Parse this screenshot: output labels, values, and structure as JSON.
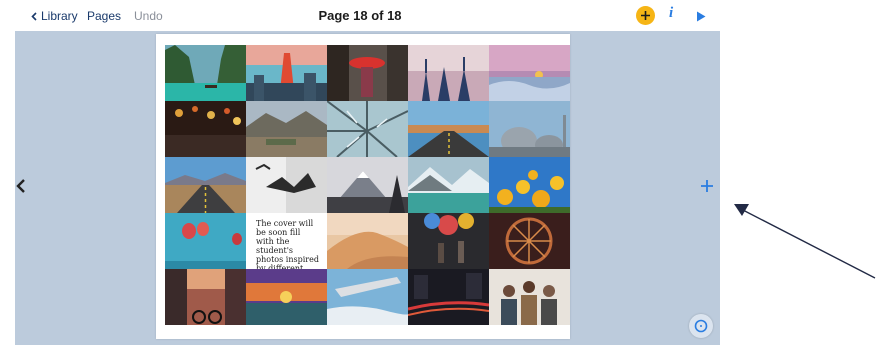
{
  "toolbar": {
    "library_label": "Library",
    "pages_label": "Pages",
    "undo_label": "Undo",
    "page_title": "Page 18 of 18",
    "add_icon": "plus-circle-icon",
    "info_icon": "info-icon",
    "info_label": "i",
    "play_icon": "play-icon"
  },
  "page": {
    "caption": "The cover will be soon fill with the student's photos inspired by different artists...",
    "photos": [
      "tropical-lagoon-boats",
      "tokyo-tower-city",
      "kimono-red-umbrella-street",
      "friends-raising-arms-sunset",
      "sea-of-clouds-pink-sky",
      "lantern-market-night",
      "desert-mountain-village",
      "frosted-tree-branches",
      "open-road-sunset",
      "mosque-domes-sky",
      "straight-road-mountains",
      "flying-seagulls",
      "mount-fuji-forest",
      "snowy-mountain-lake",
      "yellow-flowers-blue-sky",
      "hot-air-balloons",
      "caption",
      "sand-dune-dusk",
      "colorful-umbrellas-alley",
      "ferris-wheel-lights",
      "street-sunset-cyclist",
      "sunset-clouds-horizon",
      "airplane-wing-clouds",
      "city-night-traffic",
      "group-of-friends-laughing"
    ]
  },
  "nav": {
    "prev_icon": "chevron-left-icon",
    "add_page_icon": "plus-icon"
  },
  "chat": {
    "icon": "chat-bubble-icon"
  },
  "colors": {
    "accent": "#2a7de1",
    "add_button": "#f6b515",
    "workspace": "#bccbdc",
    "toolbar_text": "#1a3a6b"
  }
}
